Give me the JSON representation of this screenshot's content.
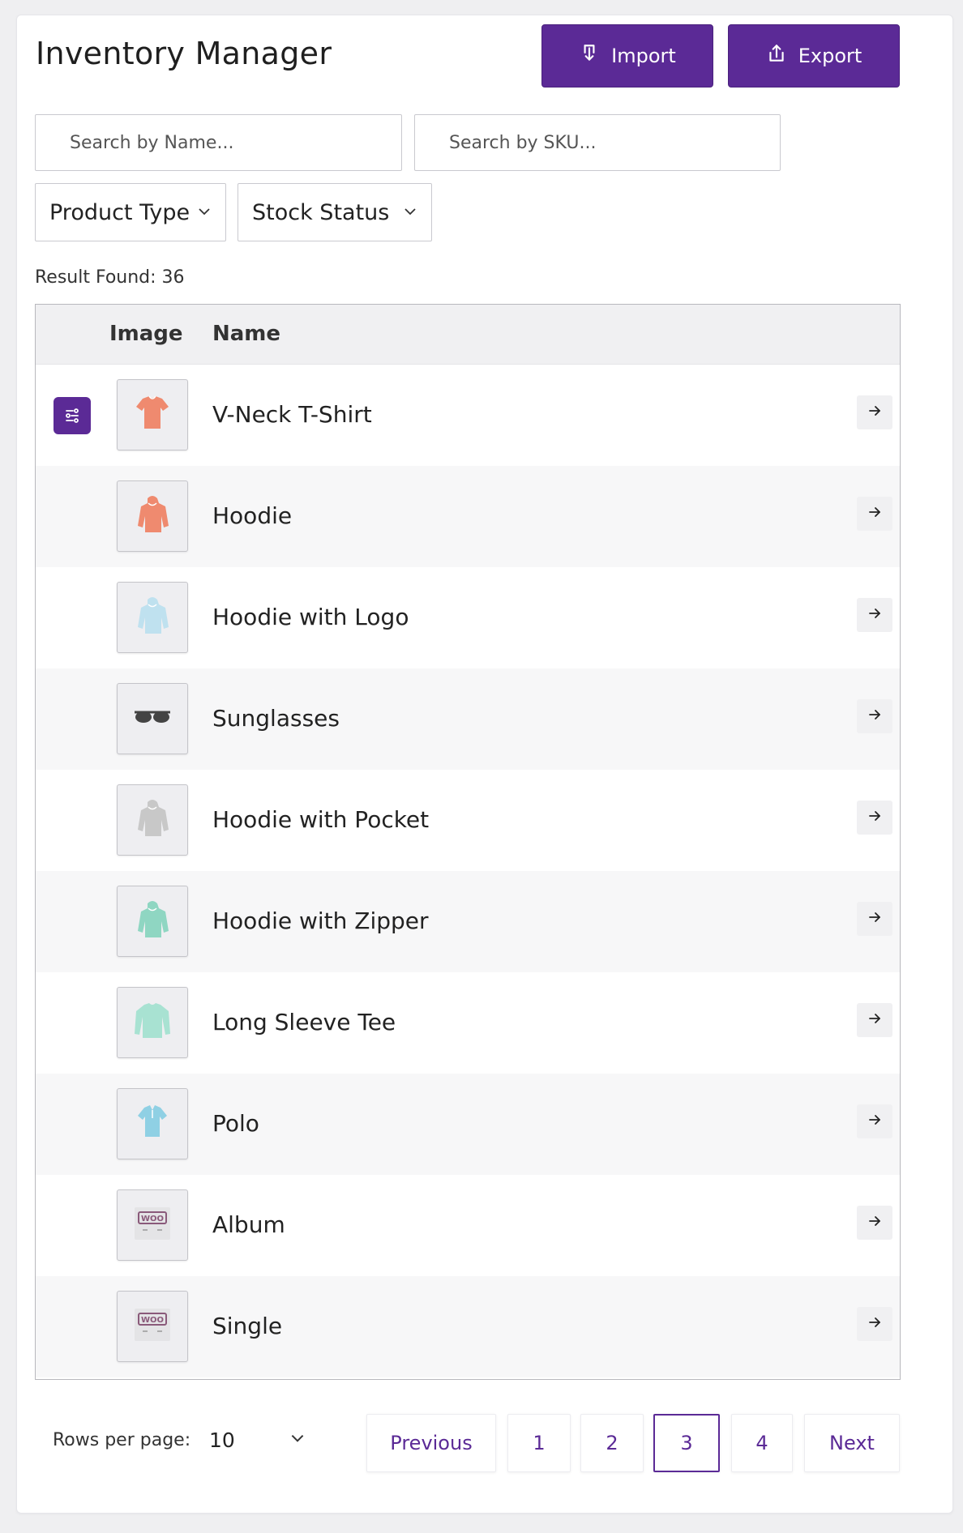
{
  "header": {
    "title": "Inventory Manager",
    "import_label": "Import",
    "export_label": "Export"
  },
  "filters": {
    "search_name_placeholder": "Search by Name...",
    "search_sku_placeholder": "Search by SKU...",
    "product_type": "Product Type",
    "stock_status": "Stock Status"
  },
  "results": {
    "label": "Result Found: 36"
  },
  "table": {
    "columns": [
      "Image",
      "Name"
    ],
    "rows": [
      {
        "name": "V-Neck T-Shirt",
        "icon": "tshirt-icon",
        "color": "#ef8a6f"
      },
      {
        "name": "Hoodie",
        "icon": "hoodie-icon",
        "color": "#ef8a6f"
      },
      {
        "name": "Hoodie with Logo",
        "icon": "hoodie-icon",
        "color": "#bfe1ef"
      },
      {
        "name": "Sunglasses",
        "icon": "sunglasses-icon",
        "color": "#444444"
      },
      {
        "name": "Hoodie with Pocket",
        "icon": "hoodie-icon",
        "color": "#c8c8c8"
      },
      {
        "name": "Hoodie with Zipper",
        "icon": "hoodie-icon",
        "color": "#8fd6c2"
      },
      {
        "name": "Long Sleeve Tee",
        "icon": "longsleeve-icon",
        "color": "#a8e2d2"
      },
      {
        "name": "Polo",
        "icon": "polo-icon",
        "color": "#8fd0e4"
      },
      {
        "name": "Album",
        "icon": "album-icon",
        "color": "#8a5a7a"
      },
      {
        "name": "Single",
        "icon": "album-icon",
        "color": "#8a5a7a"
      }
    ]
  },
  "pagination": {
    "rows_per_page_label": "Rows per page:",
    "rows_per_page_value": "10",
    "previous_label": "Previous",
    "pages": [
      "1",
      "2",
      "3",
      "4"
    ],
    "current_page": "3",
    "next_label": "Next"
  },
  "colors": {
    "accent": "#5b2a96",
    "border": "#c9c9cf",
    "row_alt": "#f7f7f8"
  }
}
